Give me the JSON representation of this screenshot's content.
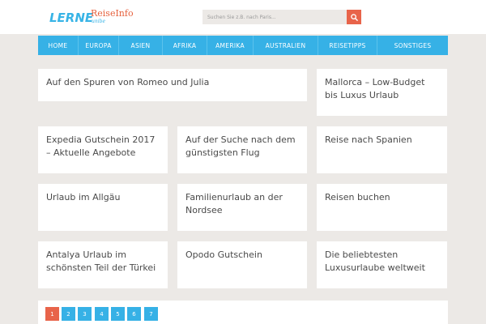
{
  "header": {
    "logo_part1": "LERNE",
    "logo_part2": "ReiseInfo",
    "logo_sub": "unibe",
    "search_placeholder": "Suchen Sie z.B. nach Paris...",
    "search_icon": "search-icon"
  },
  "nav": {
    "items": [
      "HOME",
      "EUROPA",
      "ASIEN",
      "AFRIKA",
      "AMERIKA",
      "AUSTRALIEN",
      "REISETIPPS",
      "SONSTIGES"
    ]
  },
  "articles": [
    "Auf den Spuren von Romeo und Julia",
    "Mallorca – Low-Budget bis Luxus Urlaub",
    "Expedia Gutschein 2017 – Aktuelle Angebote",
    "Auf der Suche nach dem günstigsten Flug",
    "Reise nach Spanien",
    "Urlaub im Allgäu",
    "Familienurlaub an der Nordsee",
    "Reisen buchen",
    "Antalya Urlaub im schönsten Teil der Türkei",
    "Opodo Gutschein",
    "Die beliebtesten Luxusurlaube weltweit"
  ],
  "pagination": {
    "pages": [
      "1",
      "2",
      "3",
      "4",
      "5",
      "6",
      "7"
    ],
    "current": "1"
  },
  "colors": {
    "accent_blue": "#36b1e6",
    "accent_orange": "#e8644a",
    "background": "#ece9e6"
  }
}
